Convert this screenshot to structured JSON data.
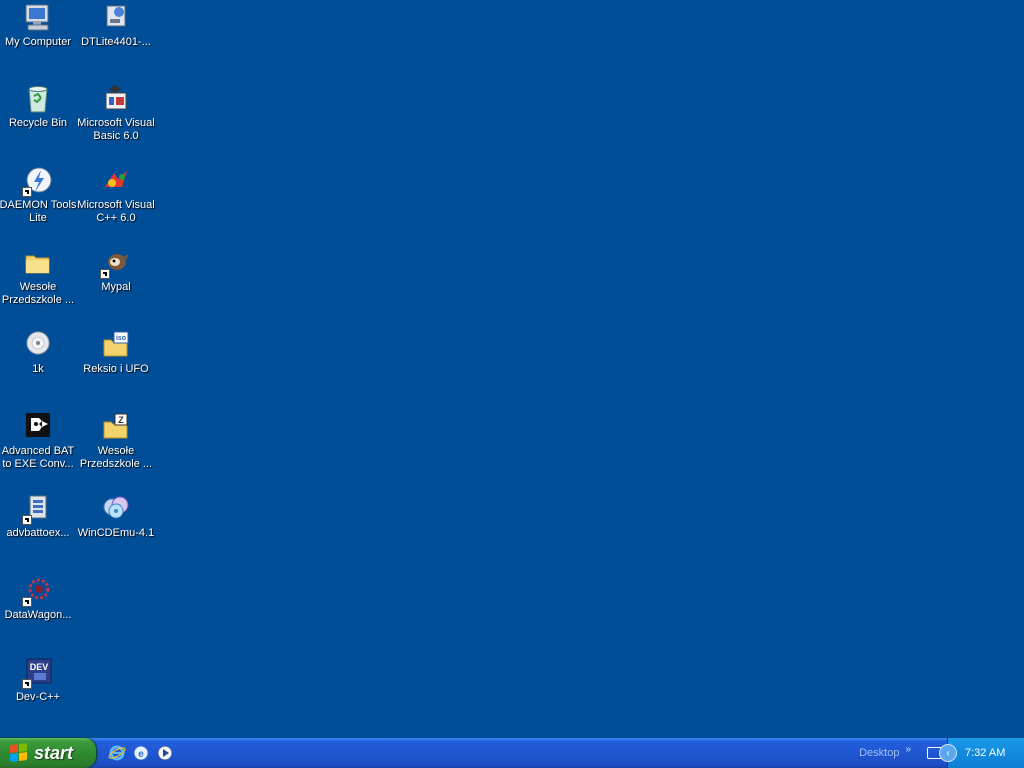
{
  "desktop": {
    "icons": [
      {
        "label": "My Computer"
      },
      {
        "label": "DTLite4401-..."
      },
      {
        "label": "Recycle Bin"
      },
      {
        "label": "Microsoft Visual\nBasic 6.0"
      },
      {
        "label": "DAEMON Tools\nLite"
      },
      {
        "label": "Microsoft Visual\nC++ 6.0"
      },
      {
        "label": "Wesołe\nPrzedszkole ..."
      },
      {
        "label": "Mypal"
      },
      {
        "label": "1k"
      },
      {
        "label": "Reksio i UFO"
      },
      {
        "label": "Advanced BAT\nto EXE Conv..."
      },
      {
        "label": "Wesołe\nPrzedszkole ..."
      },
      {
        "label": "advbattoex..."
      },
      {
        "label": "WinCDEmu-4.1"
      },
      {
        "label": "DataWagon..."
      },
      {
        "label": "Dev-C++"
      }
    ]
  },
  "taskbar": {
    "start_label": "start",
    "desktop_toolbar_label": "Desktop",
    "chevron": "»",
    "clock": "7:32 AM",
    "tray_expand": "‹"
  },
  "colors": {
    "desktop_bg": "#004e98",
    "taskbar": "#245edb",
    "start_green": "#3c9a3c",
    "tray_blue": "#128ae0"
  }
}
